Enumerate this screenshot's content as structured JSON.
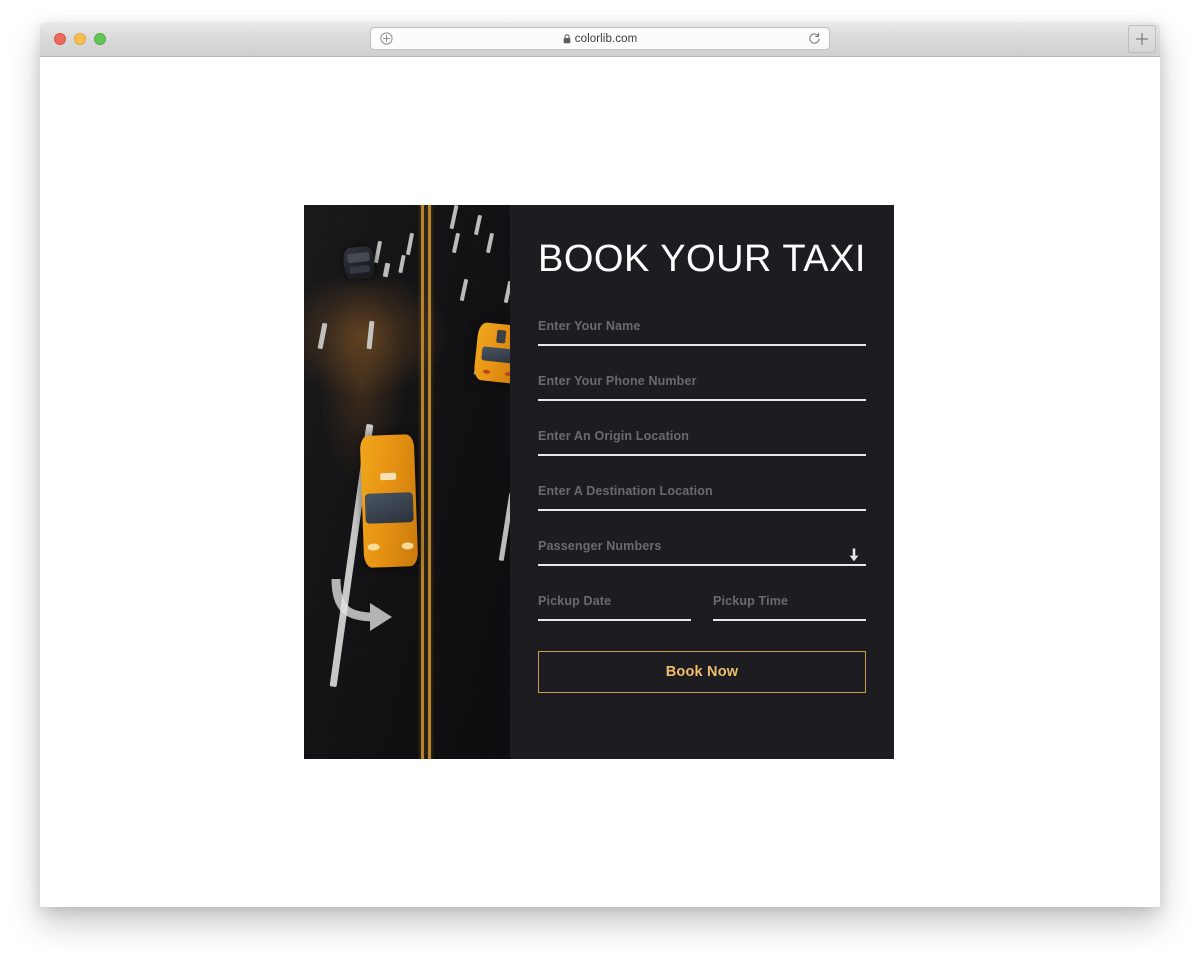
{
  "browser": {
    "traffic_lights": [
      {
        "name": "close",
        "color": "#ed6b5e"
      },
      {
        "name": "minimize",
        "color": "#f4bf4f"
      },
      {
        "name": "zoom",
        "color": "#61c554"
      }
    ],
    "address_bar": {
      "url": "colorlib.com",
      "lock_icon": "lock-icon",
      "left_icon": "add-bookmark-icon",
      "reload_icon": "reload-icon"
    },
    "new_tab_icon": "plus-icon"
  },
  "card": {
    "background": "#1d1d21",
    "photo": {
      "alt": "aerial-night-road-with-yellow-taxis",
      "taxi_color": "#e79313",
      "center_line_color": "#b5832c",
      "lane_marking_color": "#d9d9d9"
    },
    "form": {
      "title": "BOOK YOUR TAXI",
      "title_color": "#ffffff",
      "placeholder_color": "#6b6b6f",
      "rule_color": "#e8e8e8",
      "fields": [
        {
          "name": "name",
          "placeholder": "Enter Your Name",
          "value": ""
        },
        {
          "name": "phone",
          "placeholder": "Enter Your Phone Number",
          "value": ""
        },
        {
          "name": "origin",
          "placeholder": "Enter An Origin Location",
          "value": ""
        },
        {
          "name": "destination",
          "placeholder": "Enter A Destination Location",
          "value": ""
        },
        {
          "name": "passengers",
          "placeholder": "Passenger Numbers",
          "value": "",
          "icon": "arrow-down-icon"
        },
        {
          "name": "pickup_date",
          "placeholder": "Pickup Date",
          "value": ""
        },
        {
          "name": "pickup_time",
          "placeholder": "Pickup Time",
          "value": ""
        }
      ],
      "submit": {
        "label": "Book Now",
        "text_color": "#f0bd6b",
        "border_color": "#cb9b4e"
      }
    }
  }
}
